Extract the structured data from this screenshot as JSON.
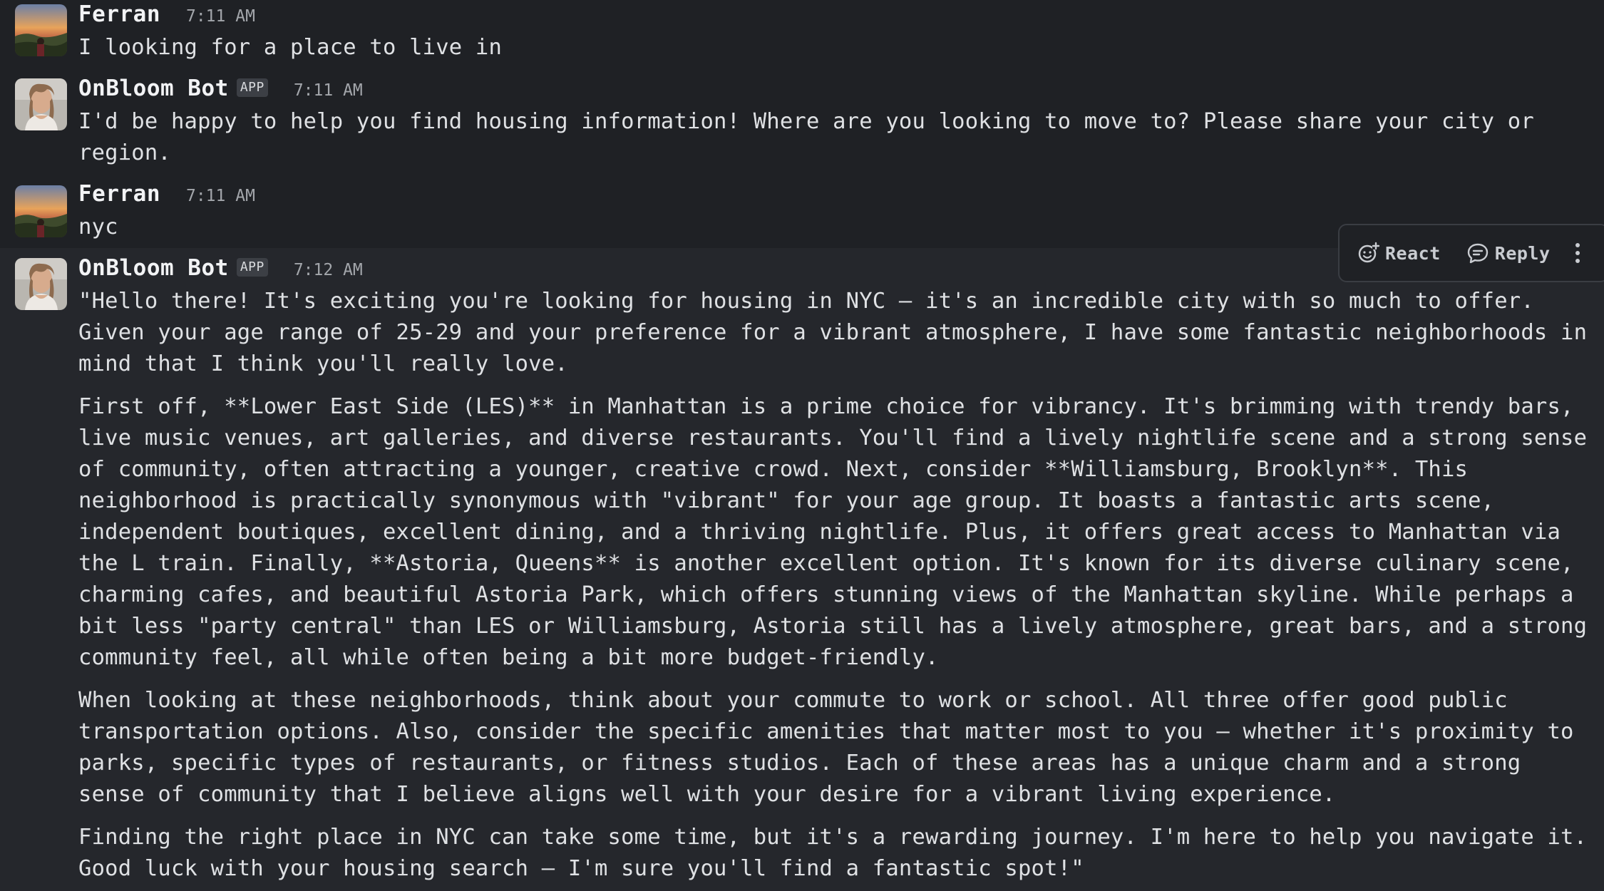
{
  "messages": [
    {
      "author": "Ferran",
      "time": "7:11 AM",
      "is_app": false,
      "paragraphs": [
        "I looking for a place to live in"
      ]
    },
    {
      "author": "OnBloom Bot",
      "time": "7:11 AM",
      "is_app": true,
      "paragraphs": [
        "I'd be happy to help you find housing information! Where are you looking to move to? Please share your city or region."
      ]
    },
    {
      "author": "Ferran",
      "time": "7:11 AM",
      "is_app": false,
      "paragraphs": [
        "nyc"
      ]
    },
    {
      "author": "OnBloom Bot",
      "time": "7:12 AM",
      "is_app": true,
      "paragraphs": [
        "\"Hello there! It's exciting you're looking for housing in NYC – it's an incredible city with so much to offer. Given your age range of 25-29 and your preference for a vibrant atmosphere, I have some fantastic neighborhoods in mind that I think you'll really love.",
        "First off, **Lower East Side (LES)** in Manhattan is a prime choice for vibrancy. It's brimming with trendy bars, live music venues, art galleries, and diverse restaurants. You'll find a lively nightlife scene and a strong sense of community, often attracting a younger, creative crowd. Next, consider **Williamsburg, Brooklyn**. This neighborhood is practically synonymous with \"vibrant\" for your age group. It boasts a fantastic arts scene, independent boutiques, excellent dining, and a thriving nightlife. Plus, it offers great access to Manhattan via the L train. Finally, **Astoria, Queens** is another excellent option. It's known for its diverse culinary scene, charming cafes, and beautiful Astoria Park, which offers stunning views of the Manhattan skyline. While perhaps a bit less \"party central\" than LES or Williamsburg, Astoria still has a lively atmosphere, great bars, and a strong community feel, all while often being a bit more budget-friendly.",
        "When looking at these neighborhoods, think about your commute to work or school. All three offer good public transportation options. Also, consider the specific amenities that matter most to you – whether it's proximity to parks, specific types of restaurants, or fitness studios. Each of these areas has a unique charm and a strong sense of community that I believe aligns well with your desire for a vibrant living experience.",
        "Finding the right place in NYC can take some time, but it's a rewarding journey. I'm here to help you navigate it. Good luck with your housing search – I'm sure you'll find a fantastic spot!\""
      ]
    }
  ],
  "app_badge_label": "APP",
  "toolbar": {
    "react_label": "React",
    "reply_label": "Reply",
    "react_icon": "emoji-add-icon",
    "reply_icon": "reply-bubble-icon",
    "more_icon": "more-vertical-icon"
  },
  "colors": {
    "background": "#1f2125",
    "hover_background": "#25272c",
    "text": "#dfe1e4",
    "muted": "#a3a6ab"
  }
}
